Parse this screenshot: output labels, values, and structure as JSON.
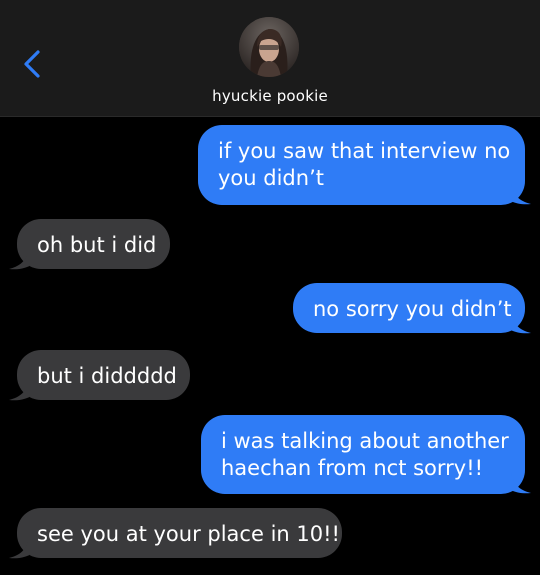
{
  "header": {
    "contact_name": "hyuckie pookie",
    "back_icon": "chevron-left-icon"
  },
  "colors": {
    "sent": "#2f7cf6",
    "received": "#3a3a3c",
    "accent": "#2f7cf6",
    "background": "#000000"
  },
  "messages": [
    {
      "side": "sent",
      "lines": [
        "if you saw that interview no",
        "you didn’t"
      ]
    },
    {
      "side": "received",
      "lines": [
        "oh but i did"
      ]
    },
    {
      "side": "sent",
      "lines": [
        "no sorry you didn’t"
      ]
    },
    {
      "side": "received",
      "lines": [
        "but i diddddd"
      ]
    },
    {
      "side": "sent",
      "lines": [
        "i was talking about another",
        "haechan from nct sorry!!"
      ]
    },
    {
      "side": "received",
      "lines": [
        "see you at your place in 10!!"
      ]
    }
  ]
}
